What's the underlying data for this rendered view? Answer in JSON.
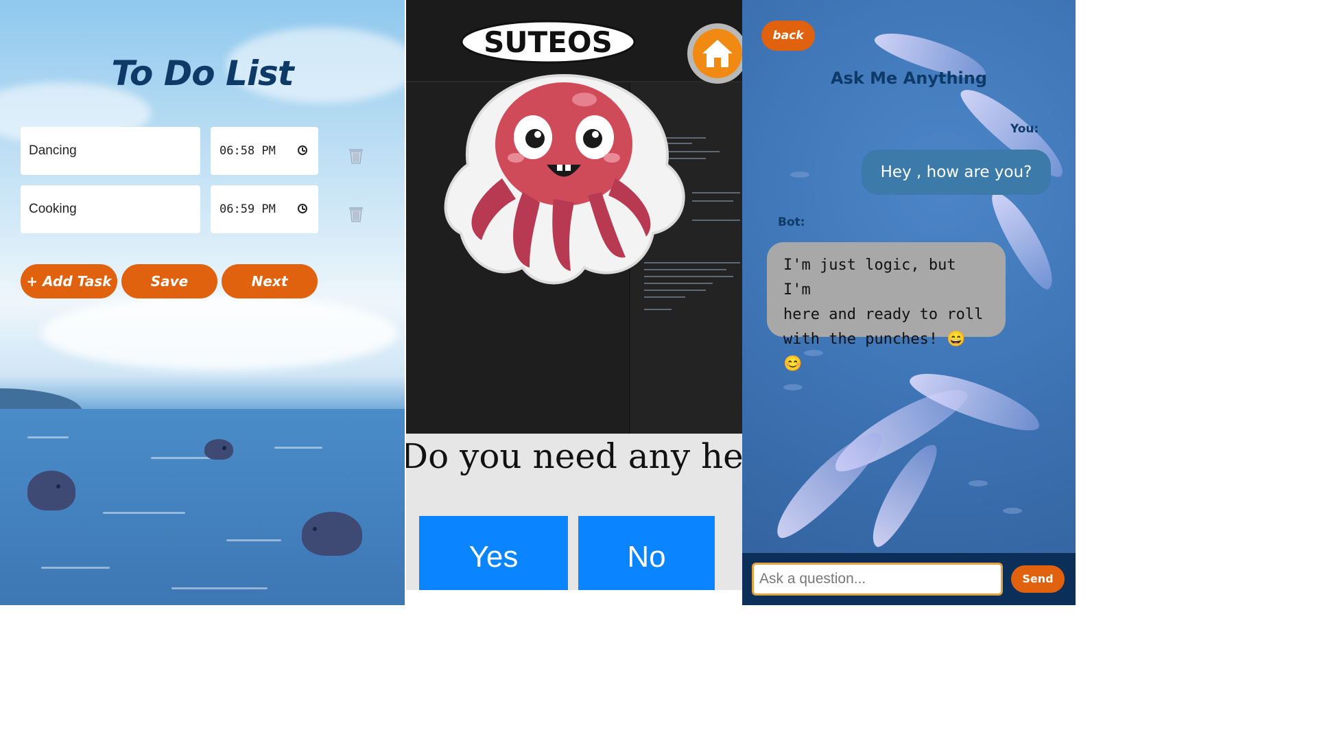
{
  "todo": {
    "title": "To Do List",
    "tasks": [
      {
        "name": "Dancing",
        "time": "06:58 PM"
      },
      {
        "name": "Cooking",
        "time": "06:59 PM"
      }
    ],
    "buttons": {
      "add": "+ Add Task",
      "save": "Save",
      "next": "Next"
    }
  },
  "helper": {
    "logo": "SUTEOS",
    "question": "Do you need any help?",
    "yes": "Yes",
    "no": "No"
  },
  "chat": {
    "back": "back",
    "title": "Ask Me Anything",
    "you_label": "You:",
    "bot_label": "Bot:",
    "user_message": "Hey , how are you?",
    "bot_lines": [
      "I'm just logic, but I'm",
      "here and ready to roll",
      "with the punches! 😄 😊"
    ],
    "input_placeholder": "Ask a question...",
    "send": "Send"
  },
  "colors": {
    "orange": "#e0620f",
    "navy": "#0e3a67",
    "blue_button": "#0a84ff"
  }
}
